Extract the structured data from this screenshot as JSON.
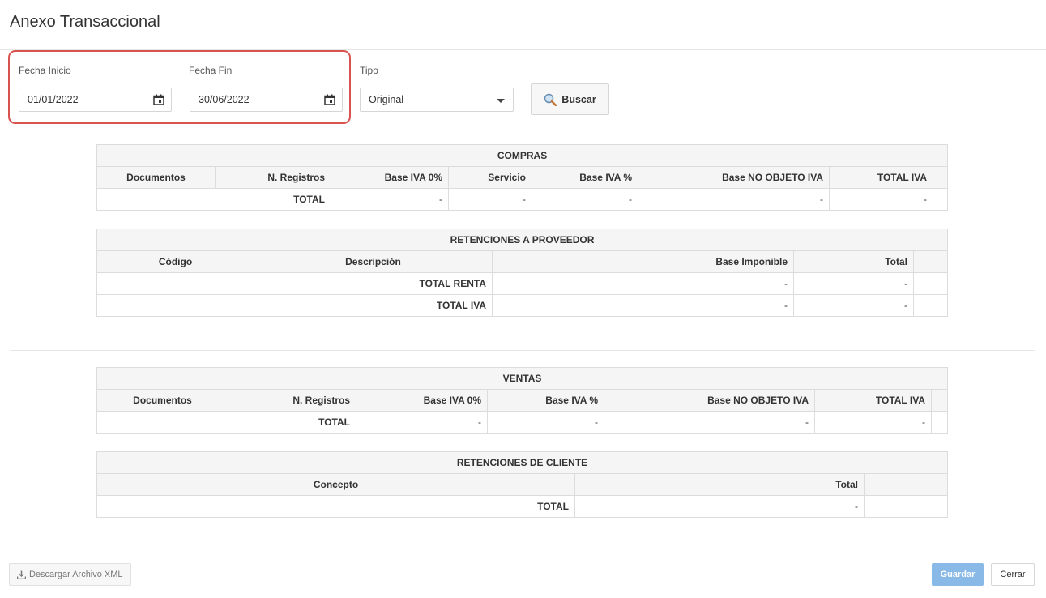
{
  "page": {
    "title": "Anexo Transaccional"
  },
  "filters": {
    "fecha_inicio": {
      "label": "Fecha Inicio",
      "value": "01/01/2022"
    },
    "fecha_fin": {
      "label": "Fecha Fin",
      "value": "30/06/2022"
    },
    "tipo": {
      "label": "Tipo",
      "value": "Original"
    },
    "buscar_label": "Buscar"
  },
  "compras": {
    "title": "COMPRAS",
    "headers": [
      "Documentos",
      "N. Registros",
      "Base IVA 0%",
      "Servicio",
      "Base IVA %",
      "Base NO OBJETO IVA",
      "TOTAL IVA"
    ],
    "total_label": "TOTAL",
    "total_values": [
      "-",
      "-",
      "-",
      "-",
      "-"
    ]
  },
  "retenciones_proveedor": {
    "title": "RETENCIONES A PROVEEDOR",
    "headers": [
      "Código",
      "Descripción",
      "Base Imponible",
      "Total"
    ],
    "rows": [
      {
        "label": "TOTAL RENTA",
        "base": "-",
        "total": "-"
      },
      {
        "label": "TOTAL IVA",
        "base": "-",
        "total": "-"
      }
    ]
  },
  "ventas": {
    "title": "VENTAS",
    "headers": [
      "Documentos",
      "N. Registros",
      "Base IVA 0%",
      "Base IVA %",
      "Base NO OBJETO IVA",
      "TOTAL IVA"
    ],
    "total_label": "TOTAL",
    "total_values": [
      "-",
      "-",
      "-",
      "-"
    ]
  },
  "retenciones_cliente": {
    "title": "RETENCIONES DE CLIENTE",
    "headers": [
      "Concepto",
      "Total"
    ],
    "total_label": "TOTAL",
    "total_value": "-"
  },
  "footer": {
    "download_label": "Descargar Archivo XML",
    "save_label": "Guardar",
    "close_label": "Cerrar"
  },
  "colors": {
    "highlight": "#d9534f",
    "primary": "#89b9e6"
  },
  "icons": {
    "calendar": "calendar-icon",
    "search": "search-icon",
    "caret": "caret-down-icon",
    "download": "download-icon"
  }
}
